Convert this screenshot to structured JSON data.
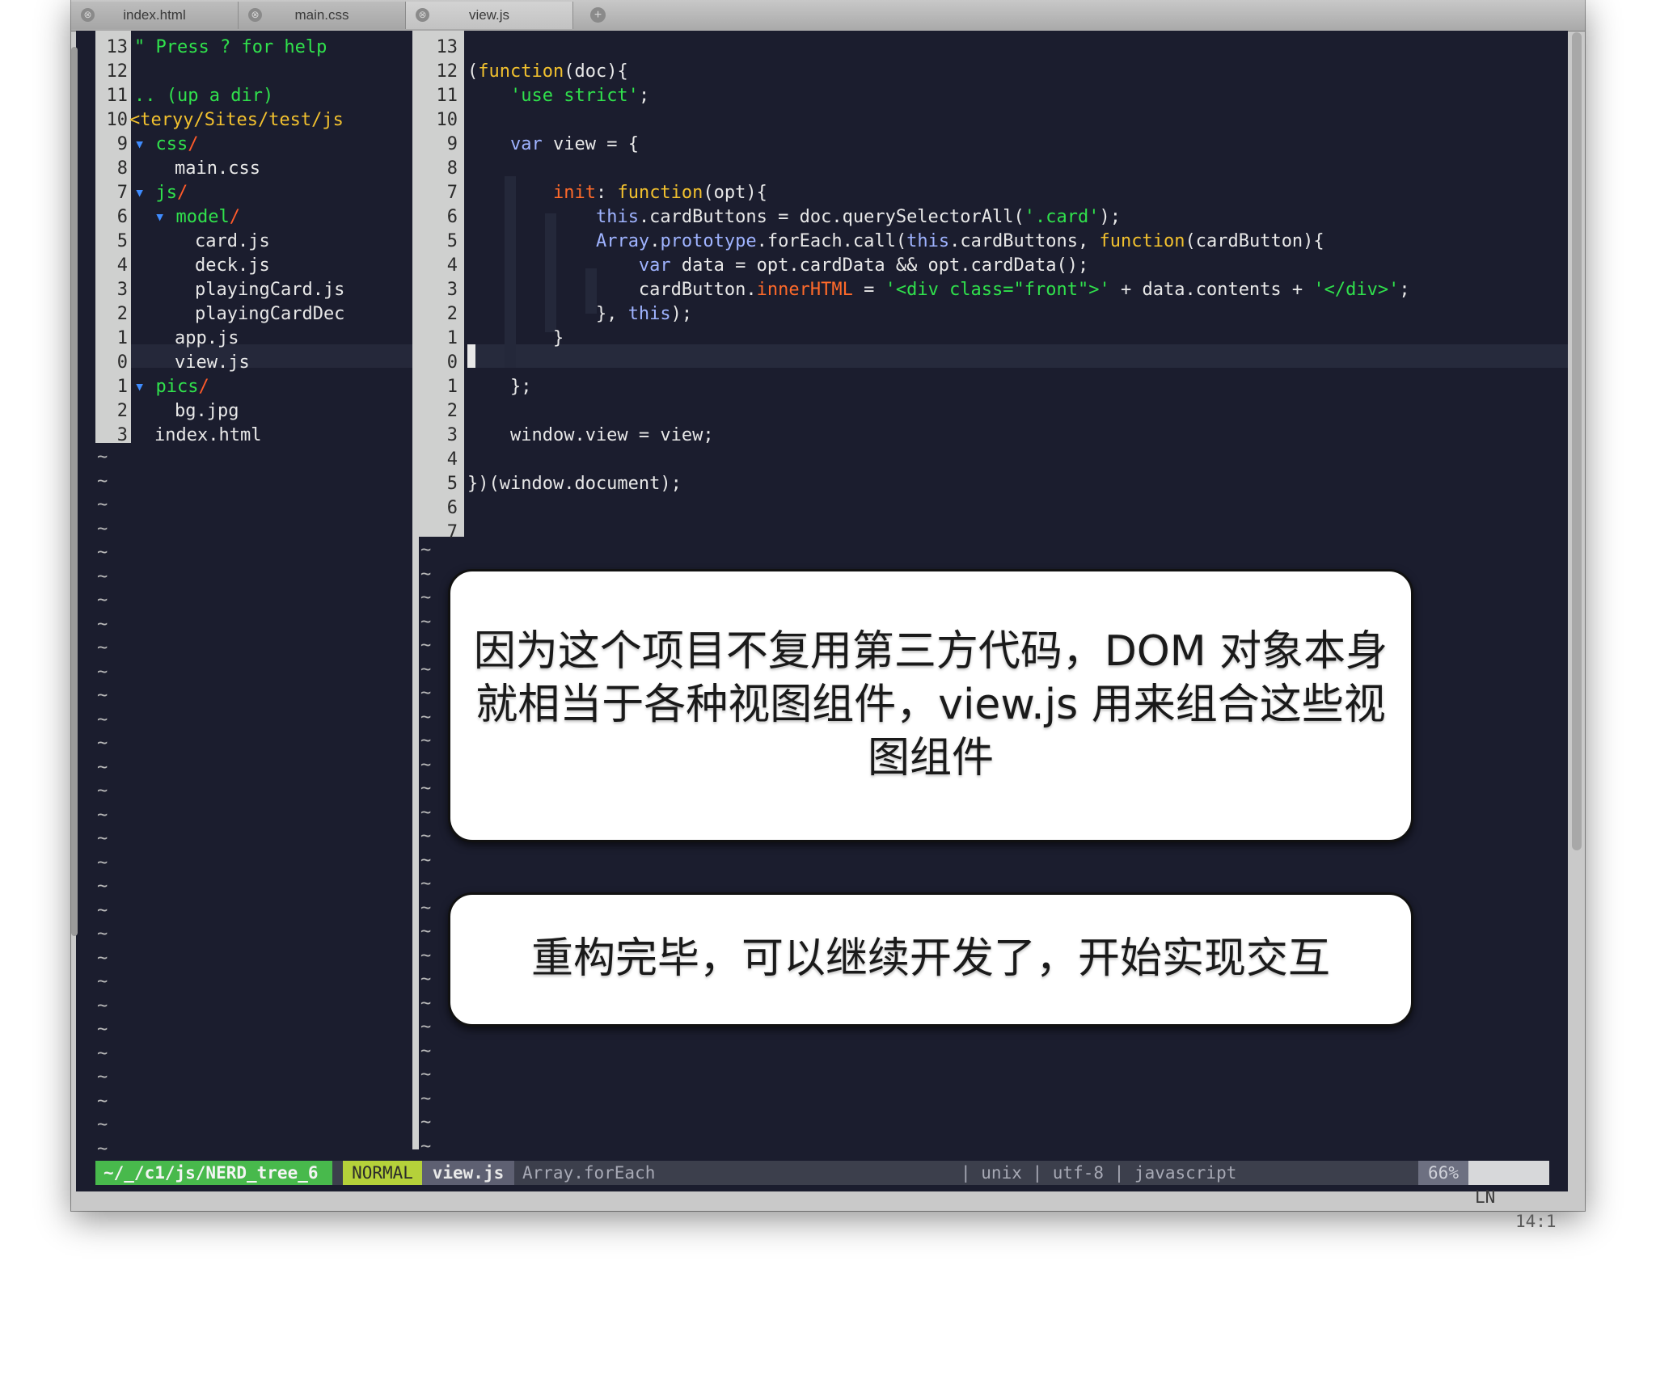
{
  "tabs": [
    {
      "label": "index.html",
      "close_icon": "⊗"
    },
    {
      "label": "main.css",
      "close_icon": "⊗"
    },
    {
      "label": "view.js",
      "close_icon": "⊗"
    }
  ],
  "new_tab_icon": "+",
  "tree": {
    "help": "\" Press ? for help",
    "up_dir": ".. (up a dir)",
    "root_path": "<teryy/Sites/test/js",
    "items": [
      {
        "arrow": "▾ ",
        "name": "css",
        "slash": "/"
      },
      {
        "name": "main.css"
      },
      {
        "arrow": "▾ ",
        "name": "js",
        "slash": "/"
      },
      {
        "arrow": "▾ ",
        "name": "model",
        "slash": "/"
      },
      {
        "name": "card.js"
      },
      {
        "name": "deck.js"
      },
      {
        "name": "playingCard.js"
      },
      {
        "name": "playingCardDec"
      },
      {
        "name": "app.js"
      },
      {
        "name": "view.js"
      },
      {
        "arrow": "▾ ",
        "name": "pics",
        "slash": "/"
      },
      {
        "name": "bg.jpg"
      },
      {
        "name": "index.html"
      }
    ],
    "line_numbers": [
      "13",
      "12",
      "11",
      "10",
      "9",
      "8",
      "7",
      "6",
      "5",
      "4",
      "3",
      "2",
      "1",
      "0",
      "1",
      "2",
      "3"
    ]
  },
  "code": {
    "line_numbers": [
      "13",
      "12",
      "11",
      "10",
      "9",
      "8",
      "7",
      "6",
      "5",
      "4",
      "3",
      "2",
      "1",
      "0",
      "1",
      "2",
      "3",
      "4",
      "5",
      "6",
      "7"
    ],
    "lines": {
      "l12": {
        "a": "(",
        "b": "function",
        "c": "(doc){"
      },
      "l11": {
        "a": "    ",
        "b": "'use strict'",
        "c": ";"
      },
      "l9": {
        "a": "    ",
        "b": "var",
        "c": " view = {"
      },
      "l7": {
        "a": "        ",
        "b": "init",
        "c": ": ",
        "d": "function",
        "e": "(opt){"
      },
      "l6": {
        "a": "            ",
        "b": "this",
        "c": ".cardButtons = doc.querySelectorAll(",
        "d": "'.card'",
        "e": ");"
      },
      "l5": {
        "a": "            ",
        "b": "Array",
        "c": ".",
        "d": "prototype",
        "e": ".forEach.call(",
        "f": "this",
        "g": ".cardButtons, ",
        "h": "function",
        "i": "(cardButton){"
      },
      "l4": {
        "a": "                ",
        "b": "var",
        "c": " data = opt.cardData && opt.cardData();"
      },
      "l3": {
        "a": "                cardButton.",
        "b": "innerHTML",
        "c": " = ",
        "d": "'<div class=\"front\">'",
        "e": " + data.contents + ",
        "f": "'</div>'",
        "g": ";"
      },
      "l2": {
        "a": "            }, ",
        "b": "this",
        "c": ");"
      },
      "l1": {
        "a": "        }"
      },
      "l_1": {
        "a": "    };"
      },
      "l_3": {
        "a": "    window.view = view;"
      },
      "l_5": {
        "a": "})(window.document);"
      }
    }
  },
  "statusline": {
    "tree": "~/_/c1/js/NERD_tree_6",
    "mode": "NORMAL",
    "file": "view.js",
    "func": "Array.forEach",
    "enc": "| unix | utf-8 | javascript",
    "percent": "66%",
    "ln_label": "LN",
    "ln_value": "14:1"
  },
  "callouts": [
    {
      "text": "因为这个项目不复用第三方代码，DOM 对象本身就相当于各种视图组件，view.js 用来组合这些视图组件"
    },
    {
      "text": "重构完毕，可以继续开发了，开始实现交互"
    }
  ],
  "colors": {
    "editor_bg": "#1b1d2e",
    "keyword": "#f2c12e",
    "string": "#30e14c",
    "builtin": "#9fb3ff",
    "property": "#ff6a2a"
  }
}
